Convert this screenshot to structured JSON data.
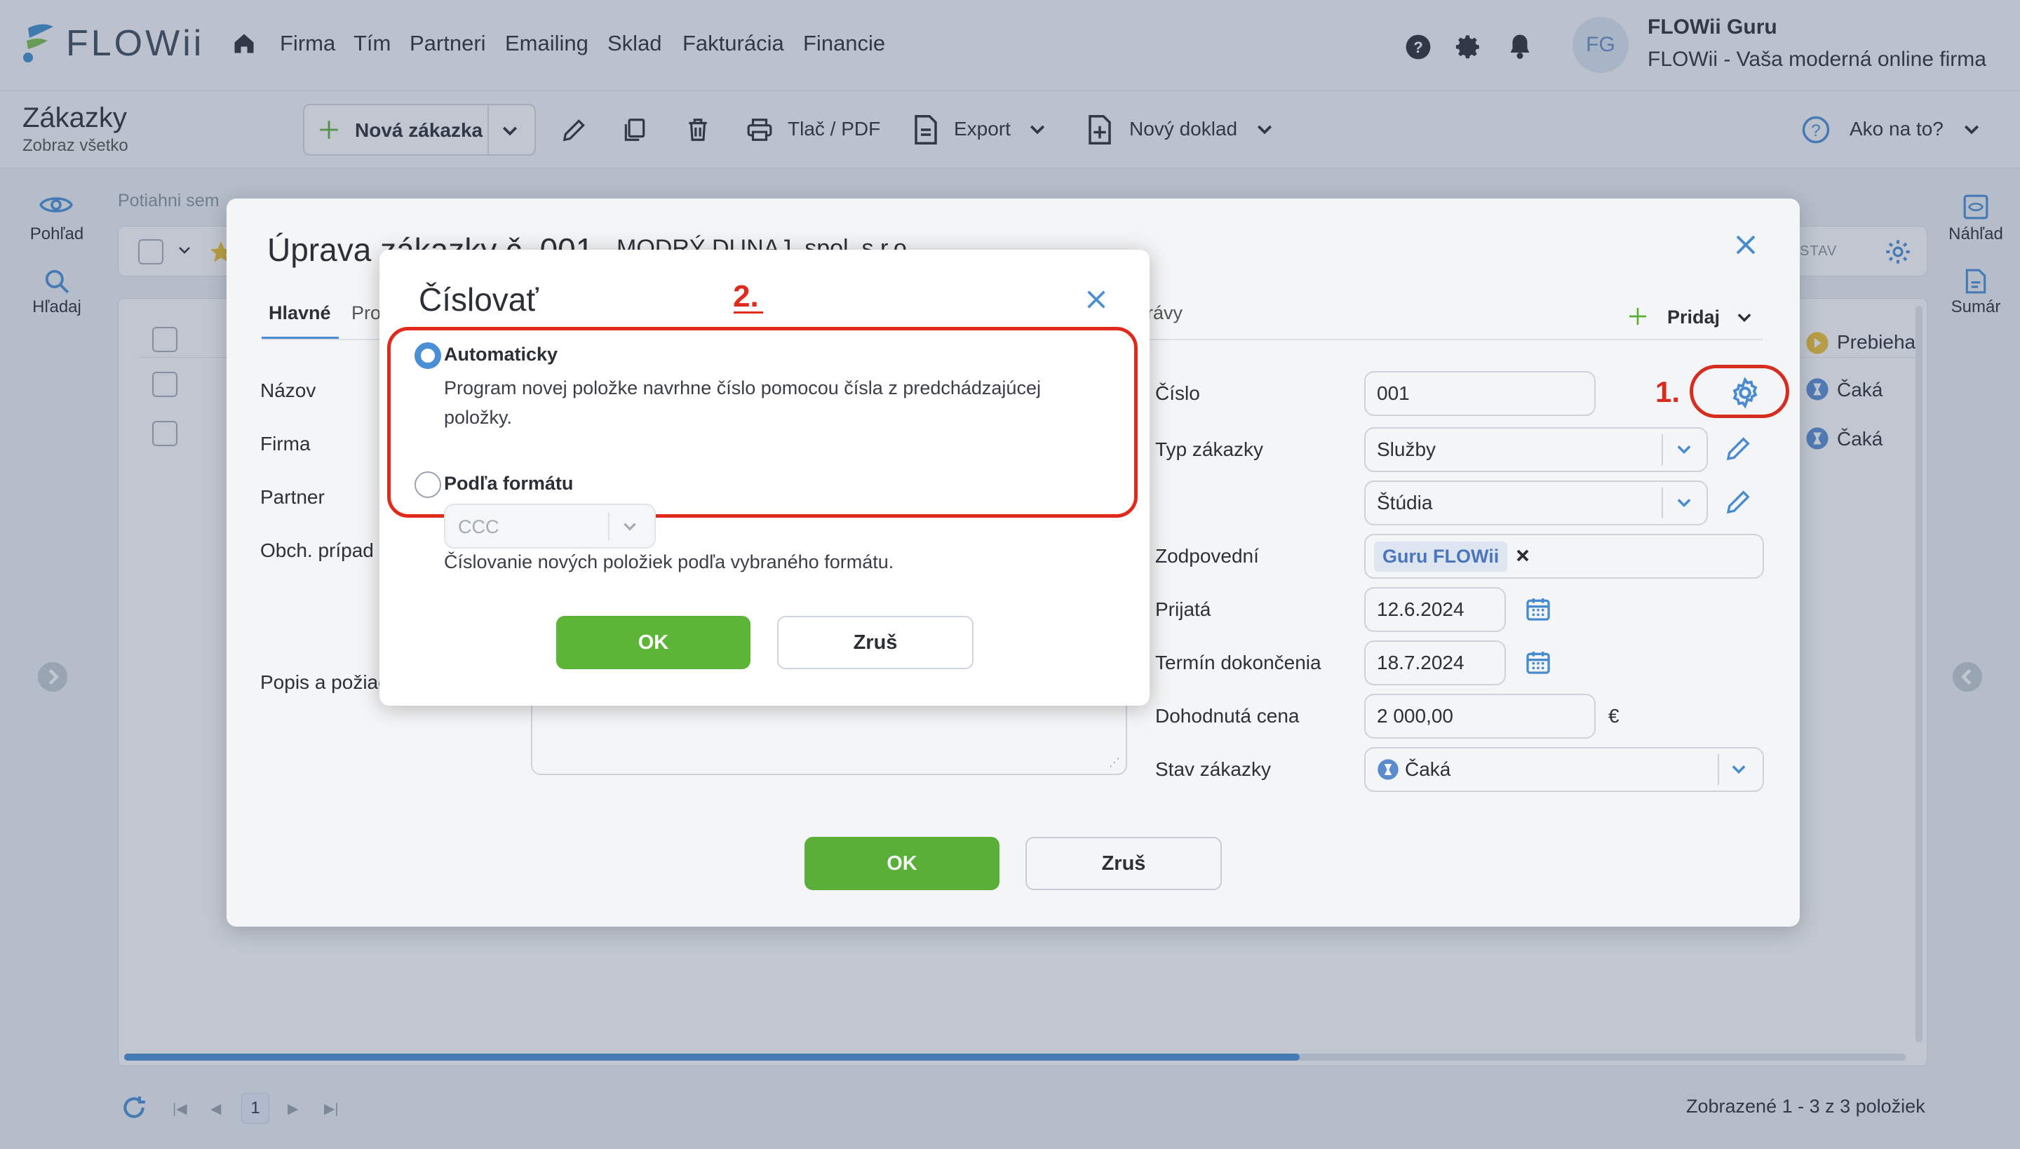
{
  "app": {
    "logo": "FLOWii",
    "nav": [
      "Firma",
      "Tím",
      "Partneri",
      "Emailing",
      "Sklad",
      "Fakturácia",
      "Financie"
    ],
    "user": {
      "initials": "FG",
      "name": "FLOWii Guru",
      "company": "FLOWii - Vaša moderná online firma"
    }
  },
  "toolbar": {
    "title": "Zákazky",
    "subtitle": "Zobraz všetko",
    "new_order": "Nová zákazka",
    "print": "Tlač / PDF",
    "export": "Export",
    "new_doc": "Nový doklad",
    "help": "Ako na to?"
  },
  "left_rail": {
    "view": "Pohľad",
    "search": "Hľadaj"
  },
  "right_rail": {
    "preview": "Náhľad",
    "summary": "Sumár"
  },
  "list": {
    "drag_hint": "Potiahni sem",
    "col_state": "STAV",
    "states": [
      "Prebieha",
      "Čaká",
      "Čaká"
    ],
    "footer": "Zobrazené 1 - 3 z 3 položiek",
    "page": "1",
    "scroll_fraction": 0.66
  },
  "edit_modal": {
    "title": "Úprava zákazky č. 001",
    "company": "MODRÝ DUNAJ, spol. s r.o.",
    "tabs": [
      "Hlavné",
      "Pro",
      "rávy"
    ],
    "add": "Pridaj",
    "left_labels": [
      "Názov",
      "Firma",
      "Partner",
      "Obch. prípad",
      "Popis a požiac"
    ],
    "fields": {
      "number_label": "Číslo",
      "number_value": "001",
      "type_label": "Typ zákazky",
      "type_value": "Služby",
      "subtype_value": "Štúdia",
      "responsible_label": "Zodpovední",
      "responsible_tag": "Guru FLOWii",
      "received_label": "Prijatá",
      "received_value": "12.6.2024",
      "due_label": "Termín dokončenia",
      "due_value": "18.7.2024",
      "price_label": "Dohodnutá cena",
      "price_value": "2 000,00",
      "currency": "€",
      "state_label": "Stav zákazky",
      "state_value": "Čaká"
    },
    "ok": "OK",
    "cancel": "Zruš"
  },
  "numbering_dialog": {
    "title": "Číslovať",
    "auto_label": "Automaticky",
    "auto_desc": "Program novej položke navrhne číslo pomocou čísla z predchádzajúcej položky.",
    "format_label": "Podľa formátu",
    "format_value": "CCC",
    "format_desc": "Číslovanie nových položiek podľa vybraného formátu.",
    "ok": "OK",
    "cancel": "Zruš"
  },
  "annotations": {
    "step1": "1.",
    "step2": "2."
  },
  "colors": {
    "accent_green": "#5cb536",
    "accent_blue": "#4a8fd6",
    "annotation_red": "#e02b1c"
  }
}
